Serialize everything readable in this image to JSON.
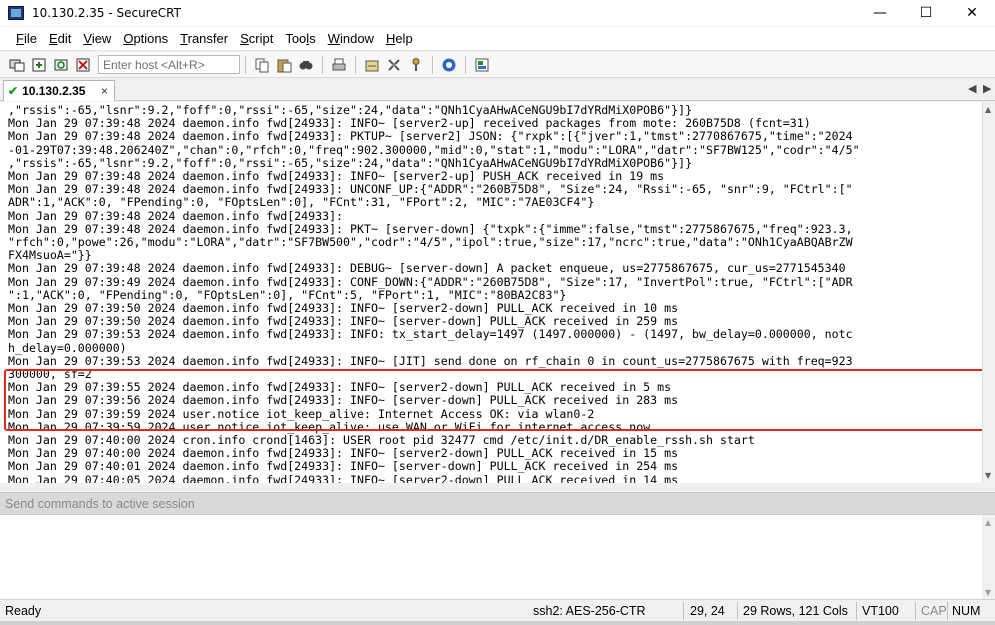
{
  "window": {
    "title": "10.130.2.35 - SecureCRT",
    "controls": {
      "minimize": "—",
      "maximize": "☐",
      "close": "✕"
    }
  },
  "menu": [
    "File",
    "Edit",
    "View",
    "Options",
    "Transfer",
    "Script",
    "Tools",
    "Window",
    "Help"
  ],
  "menu_underline": [
    "F",
    "E",
    "V",
    "O",
    "T",
    "S",
    "l",
    "W",
    "H"
  ],
  "toolbar": {
    "host_placeholder": "Enter host <Alt+R>"
  },
  "tab": {
    "label": "10.130.2.35",
    "close": "×"
  },
  "tab_nav": {
    "prev": "◀",
    "next": "▶"
  },
  "terminal": {
    "lines": [
      ",\"rssis\":-65,\"lsnr\":9.2,\"foff\":0,\"rssi\":-65,\"size\":24,\"data\":\"QNh1CyaAHwACeNGU9bI7dYRdMiX0POB6\"}]}",
      "Mon Jan 29 07:39:48 2024 daemon.info fwd[24933]: INFO~ [server2-up] received packages from mote: 260B75D8 (fcnt=31)",
      "Mon Jan 29 07:39:48 2024 daemon.info fwd[24933]: PKTUP~ [server2] JSON: {\"rxpk\":[{\"jver\":1,\"tmst\":2770867675,\"time\":\"2024",
      "-01-29T07:39:48.206240Z\",\"chan\":0,\"rfch\":0,\"freq\":902.300000,\"mid\":0,\"stat\":1,\"modu\":\"LORA\",\"datr\":\"SF7BW125\",\"codr\":\"4/5\"",
      ",\"rssis\":-65,\"lsnr\":9.2,\"foff\":0,\"rssi\":-65,\"size\":24,\"data\":\"QNh1CyaAHwACeNGU9bI7dYRdMiX0POB6\"}]}",
      "Mon Jan 29 07:39:48 2024 daemon.info fwd[24933]: INFO~ [server2-up] PUSH_ACK received in 19 ms",
      "Mon Jan 29 07:39:48 2024 daemon.info fwd[24933]: UNCONF_UP:{\"ADDR\":\"260B75D8\", \"Size\":24, \"Rssi\":-65, \"snr\":9, \"FCtrl\":[\"",
      "ADR\":1,\"ACK\":0, \"FPending\":0, \"FOptsLen\":0], \"FCnt\":31, \"FPort\":2, \"MIC\":\"7AE03CF4\"}",
      "Mon Jan 29 07:39:48 2024 daemon.info fwd[24933]:",
      "Mon Jan 29 07:39:48 2024 daemon.info fwd[24933]: PKT~ [server-down] {\"txpk\":{\"imme\":false,\"tmst\":2775867675,\"freq\":923.3,",
      "\"rfch\":0,\"powe\":26,\"modu\":\"LORA\",\"datr\":\"SF7BW500\",\"codr\":\"4/5\",\"ipol\":true,\"size\":17,\"ncrc\":true,\"data\":\"ONh1CyaABQABrZW",
      "FX4MsuoA=\"}}",
      "Mon Jan 29 07:39:48 2024 daemon.info fwd[24933]: DEBUG~ [server-down] A packet enqueue, us=2775867675, cur_us=2771545340",
      "Mon Jan 29 07:39:49 2024 daemon.info fwd[24933]: CONF_DOWN:{\"ADDR\":\"260B75D8\", \"Size\":17, \"InvertPol\":true, \"FCtrl\":[\"ADR",
      "\":1,\"ACK\":0, \"FPending\":0, \"FOptsLen\":0], \"FCnt\":5, \"FPort\":1, \"MIC\":\"80BA2C83\"}",
      "Mon Jan 29 07:39:50 2024 daemon.info fwd[24933]: INFO~ [server2-down] PULL_ACK received in 10 ms",
      "Mon Jan 29 07:39:50 2024 daemon.info fwd[24933]: INFO~ [server-down] PULL_ACK received in 259 ms",
      "Mon Jan 29 07:39:53 2024 daemon.info fwd[24933]: INFO: tx_start_delay=1497 (1497.000000) - (1497, bw_delay=0.000000, notc",
      "h_delay=0.000000)",
      "Mon Jan 29 07:39:53 2024 daemon.info fwd[24933]: INFO~ [JIT] send done on rf_chain 0 in count_us=2775867675 with freq=923",
      "300000, sf=2",
      "Mon Jan 29 07:39:55 2024 daemon.info fwd[24933]: INFO~ [server2-down] PULL_ACK received in 5 ms",
      "Mon Jan 29 07:39:56 2024 daemon.info fwd[24933]: INFO~ [server-down] PULL_ACK received in 283 ms",
      "Mon Jan 29 07:39:59 2024 user.notice iot_keep_alive: Internet Access OK: via wlan0-2",
      "Mon Jan 29 07:39:59 2024 user.notice iot_keep_alive: use WAN or WiFi for internet access now",
      "Mon Jan 29 07:40:00 2024 cron.info crond[1463]: USER root pid 32477 cmd /etc/init.d/DR_enable_rssh.sh start",
      "Mon Jan 29 07:40:00 2024 daemon.info fwd[24933]: INFO~ [server2-down] PULL_ACK received in 15 ms",
      "Mon Jan 29 07:40:01 2024 daemon.info fwd[24933]: INFO~ [server-down] PULL_ACK received in 254 ms",
      "Mon Jan 29 07:40:05 2024 daemon.info fwd[24933]: INFO~ [server2-down] PULL_ACK received in 14 ms"
    ]
  },
  "command_window": {
    "header": "Send commands to active session"
  },
  "status": {
    "ready": "Ready",
    "cipher": "ssh2: AES-256-CTR",
    "cursor": "29,  24",
    "size": "29 Rows, 121 Cols",
    "emulation": "VT100",
    "cap": "CAP",
    "num": "NUM"
  }
}
